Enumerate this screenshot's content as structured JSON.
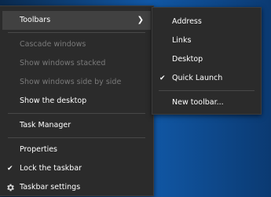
{
  "main_menu": {
    "toolbars": "Toolbars",
    "cascade": "Cascade windows",
    "stacked": "Show windows stacked",
    "side_by_side": "Show windows side by side",
    "show_desktop": "Show the desktop",
    "task_manager": "Task Manager",
    "properties": "Properties",
    "lock_taskbar": "Lock the taskbar",
    "taskbar_settings": "Taskbar settings"
  },
  "toolbars_submenu": {
    "address": "Address",
    "links": "Links",
    "desktop": "Desktop",
    "quick_launch": "Quick Launch",
    "new_toolbar": "New toolbar..."
  },
  "icons": {
    "checkmark": "check-icon",
    "submenu_arrow": "chevron-right-icon",
    "settings": "gear-icon"
  }
}
